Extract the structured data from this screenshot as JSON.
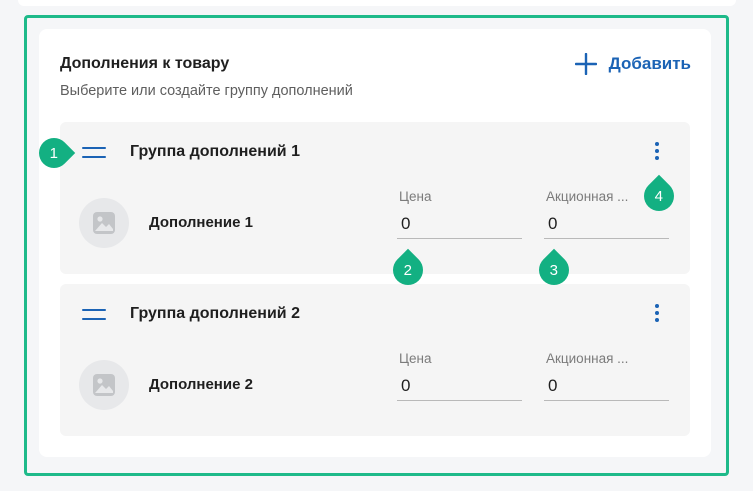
{
  "section": {
    "title": "Дополнения к товару",
    "subtitle": "Выберите или создайте группу дополнений",
    "add_label": "Добавить"
  },
  "groups": [
    {
      "title": "Группа дополнений 1",
      "item": {
        "name": "Дополнение 1",
        "price_label": "Цена",
        "price_value": "0",
        "promo_label": "Акционная ...",
        "promo_value": "0"
      }
    },
    {
      "title": "Группа дополнений 2",
      "item": {
        "name": "Дополнение 2",
        "price_label": "Цена",
        "price_value": "0",
        "promo_label": "Акционная ...",
        "promo_value": "0"
      }
    }
  ],
  "annotations": [
    "1",
    "2",
    "3",
    "4"
  ],
  "colors": {
    "accent": "#1b63b5",
    "annotation": "#13b082",
    "frame": "#1eba8a"
  }
}
